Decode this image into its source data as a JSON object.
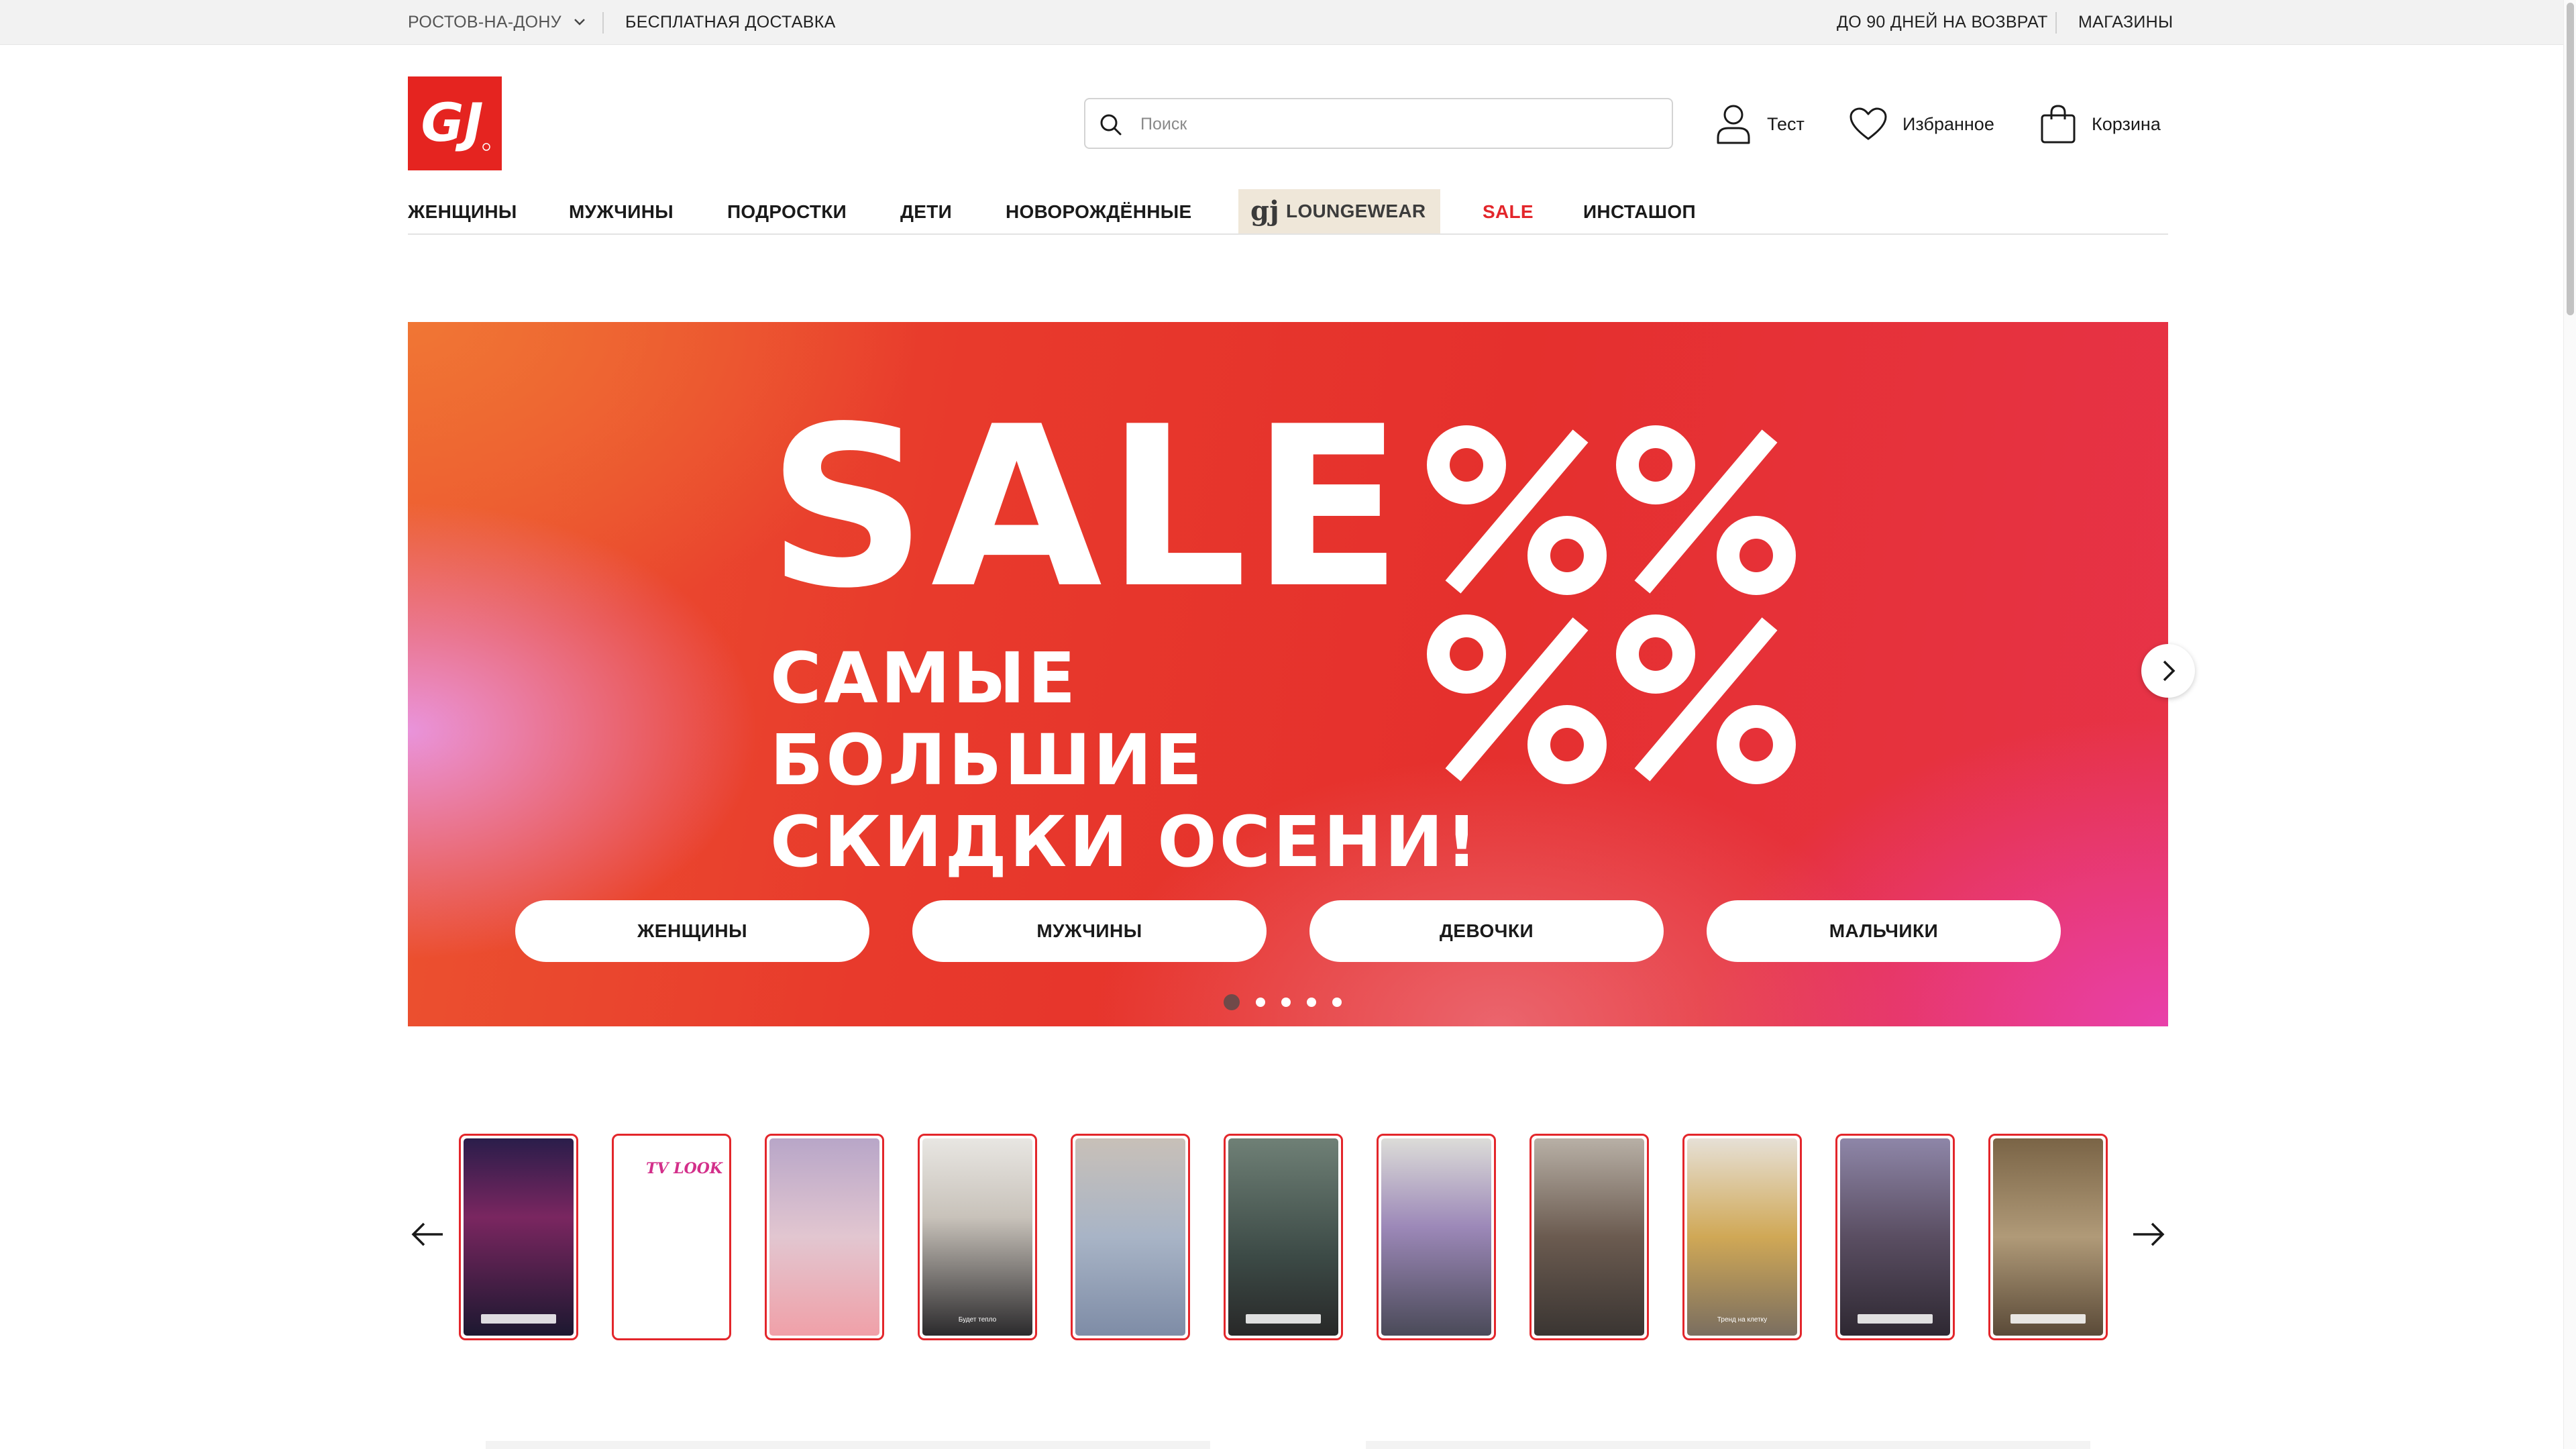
{
  "topbar": {
    "city": "РОСТОВ-НА-ДОНУ",
    "delivery": "БЕСПЛАТНАЯ ДОСТАВКА",
    "return_policy": "ДО 90 ДНЕЙ НА ВОЗВРАТ",
    "stores": "МАГАЗИНЫ"
  },
  "brand": {
    "logo_text": "GJ",
    "color": "#e52420"
  },
  "search": {
    "placeholder": "Поиск",
    "value": ""
  },
  "header_actions": {
    "user": "Тест",
    "favorites": "Избранное",
    "cart": "Корзина"
  },
  "nav": {
    "items": [
      "ЖЕНЩИНЫ",
      "МУЖЧИНЫ",
      "ПОДРОСТКИ",
      "ДЕТИ",
      "НОВОРОЖДЁННЫЕ",
      "LOUNGEWEAR",
      "SALE",
      "ИНСТАШОП"
    ],
    "lounge_logo": "gj",
    "sale_color": "#e3262b"
  },
  "hero": {
    "title": "SALE",
    "subtitle_line1": "САМЫЕ БОЛЬШИЕ",
    "subtitle_line2": "СКИДКИ ОСЕНИ!",
    "buttons": [
      "ЖЕНЩИНЫ",
      "МУЖЧИНЫ",
      "ДЕВОЧКИ",
      "МАЛЬЧИКИ"
    ],
    "slides_total": 5,
    "active_slide": 1
  },
  "stories": {
    "count": 11,
    "captions": [
      "",
      "",
      "",
      "Будет тепло",
      "",
      "",
      "",
      "",
      "Тренд на клетку",
      "",
      ""
    ],
    "tv_look": "TV LOOK"
  },
  "colors": {
    "accent": "#e3262b",
    "topbar_bg": "#f2f2f2"
  }
}
